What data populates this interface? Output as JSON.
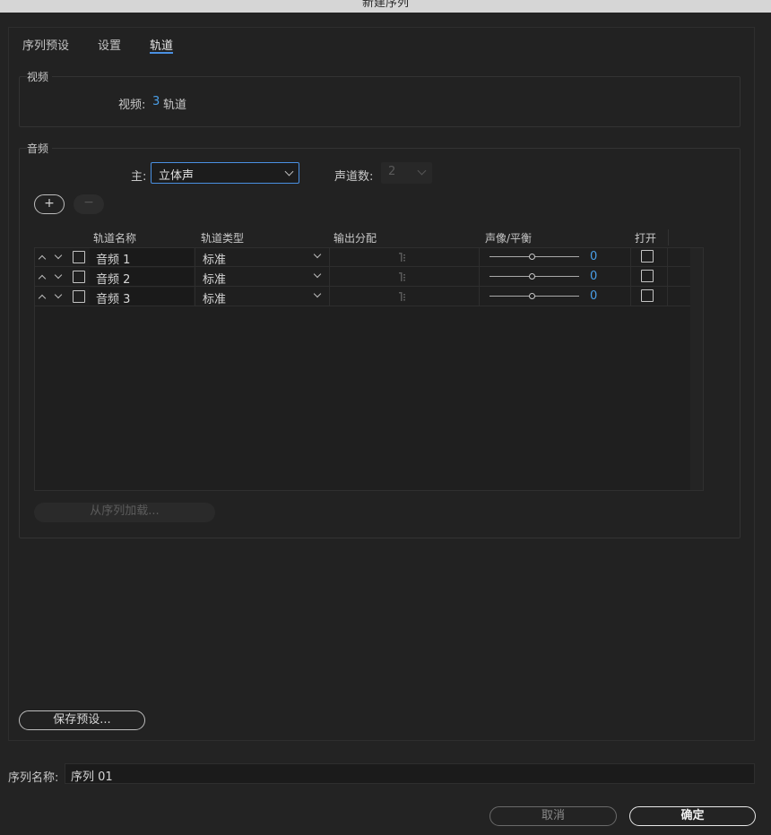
{
  "window": {
    "title": "新建序列"
  },
  "tabs": [
    {
      "label": "序列预设"
    },
    {
      "label": "设置"
    },
    {
      "label": "轨道"
    }
  ],
  "video": {
    "group_title": "视频",
    "tracks_label": "视频:",
    "tracks_count": "3",
    "tracks_unit": "轨道"
  },
  "audio": {
    "group_title": "音频",
    "master_label": "主:",
    "master_value": "立体声",
    "channels_label": "声道数:",
    "channels_value": "2",
    "add_symbol": "+",
    "remove_symbol": "−",
    "columns": {
      "name": "轨道名称",
      "type": "轨道类型",
      "output": "输出分配",
      "pan": "声像/平衡",
      "open": "打开"
    },
    "tracks": [
      {
        "name": "音频 1",
        "type": "标准",
        "pan": "0"
      },
      {
        "name": "音频 2",
        "type": "标准",
        "pan": "0"
      },
      {
        "name": "音频 3",
        "type": "标准",
        "pan": "0"
      }
    ],
    "load_from_sequence": "从序列加载..."
  },
  "save_preset": "保存预设...",
  "sequence_name": {
    "label": "序列名称:",
    "value": "序列 01"
  },
  "buttons": {
    "cancel": "取消",
    "ok": "确定"
  },
  "colors": {
    "accent": "#4a90e2",
    "value_blue": "#4a9fe8",
    "background": "#232323"
  }
}
